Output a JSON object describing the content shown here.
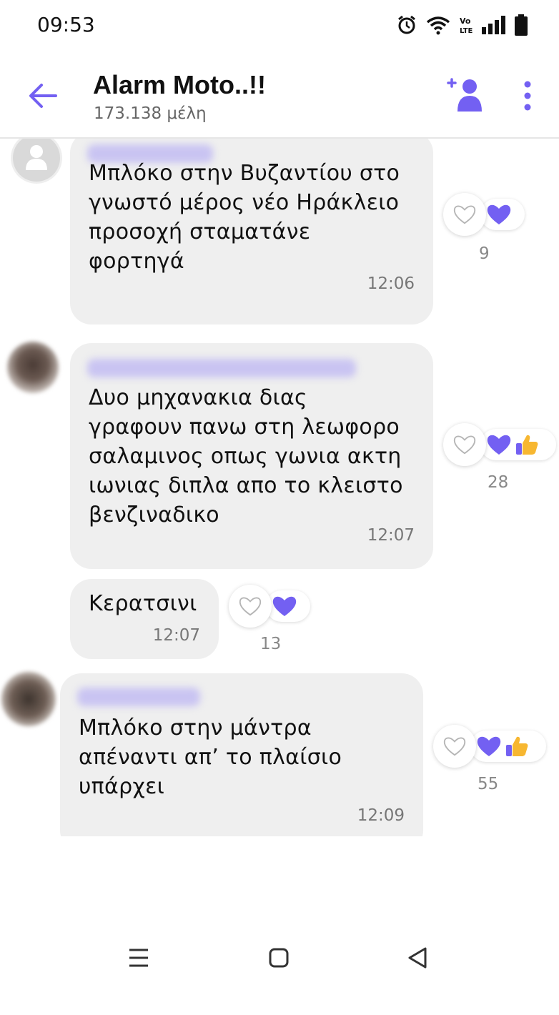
{
  "status_bar": {
    "time": "09:53",
    "icons": [
      "alarm-icon",
      "wifi-icon",
      "volte-icon",
      "signal-icon",
      "battery-icon"
    ],
    "volte_text": "Vo LTE"
  },
  "header": {
    "title": "Alarm Moto..!!",
    "subtitle": "173.138 μέλη",
    "accent_color": "#7360f2"
  },
  "messages": [
    {
      "text": "Μπλόκο στην Βυζαντίου στο\nγνωστό μέρος νέο Ηράκλειο\nπροσοχή σταματάνε\nφορτηγά",
      "time": "12:06",
      "reactions": [
        "heart"
      ],
      "reaction_count": "9"
    },
    {
      "text": "Δυο μηχανακια διας\nγραφουν πανω στη λεωφορο\nσαλαμινος οπως γωνια ακτη\nιωνιας διπλα απο το κλειστο\nβενζιναδικο",
      "time": "12:07",
      "reactions": [
        "heart",
        "thumbs-up"
      ],
      "reaction_count": "28"
    },
    {
      "text": "Κερατσινι",
      "time": "12:07",
      "reactions": [
        "heart"
      ],
      "reaction_count": "13"
    },
    {
      "text": "Μπλόκο στην μάντρα\nαπέναντι απ’ το πλαίσιο\nυπάρχει",
      "time": "12:09",
      "reactions": [
        "heart",
        "thumbs-up"
      ],
      "reaction_count": "55"
    }
  ],
  "nav_bar": {
    "buttons": [
      "recents-icon",
      "home-icon",
      "back-triangle-icon"
    ]
  }
}
